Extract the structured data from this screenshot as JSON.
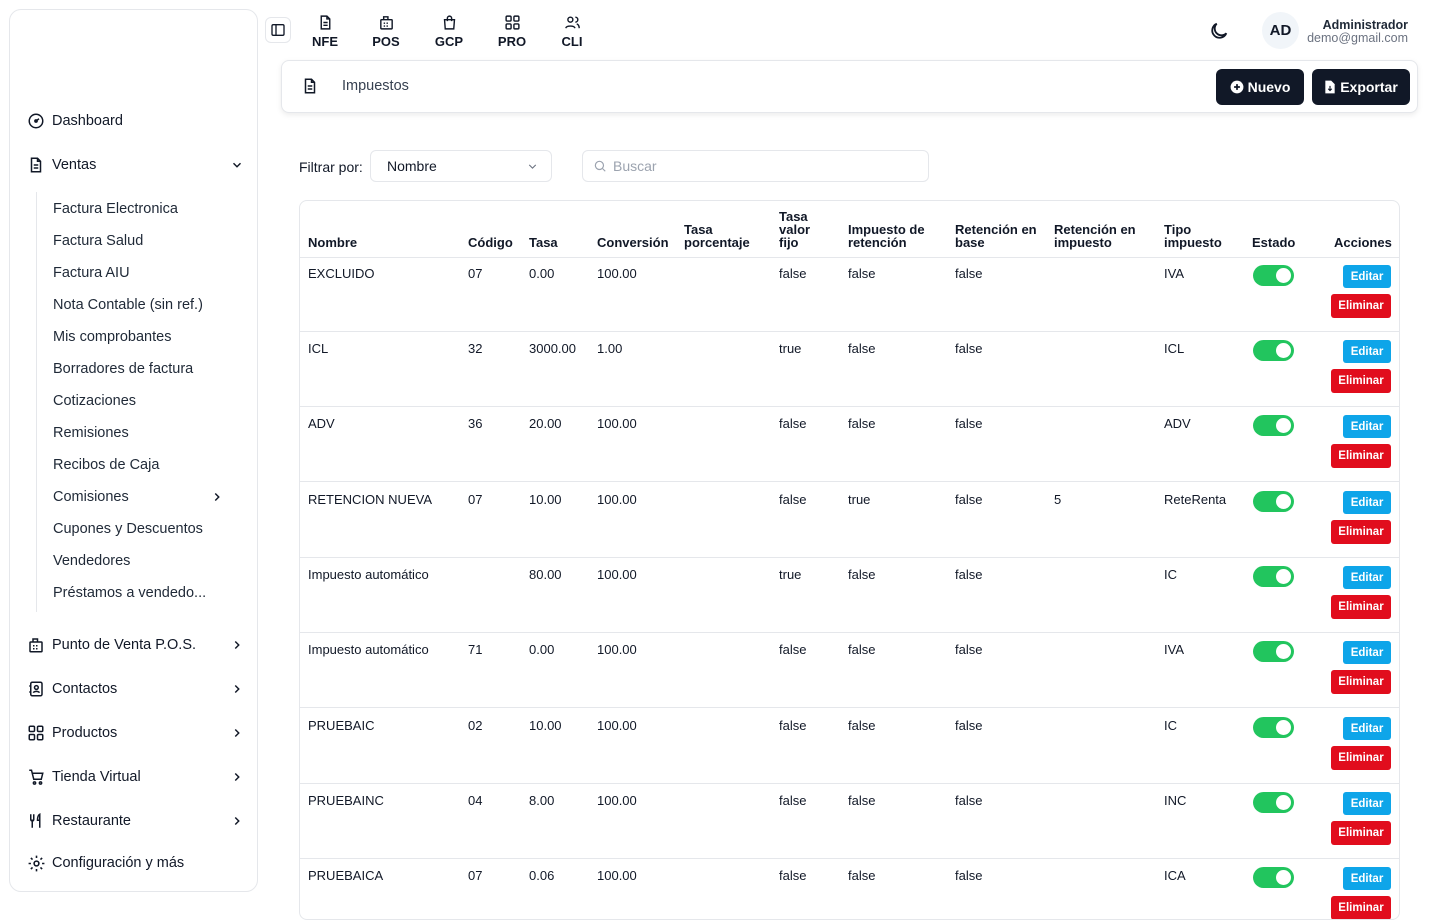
{
  "sidebar": {
    "dashboard": "Dashboard",
    "ventas": "Ventas",
    "ventas_items": [
      "Factura Electronica",
      "Factura Salud",
      "Factura AIU",
      "Nota Contable (sin ref.)",
      "Mis comprobantes",
      "Borradores de factura",
      "Cotizaciones",
      "Remisiones",
      "Recibos de Caja",
      "Comisiones",
      "Cupones y Descuentos",
      "Vendedores",
      "Préstamos a vendedo..."
    ],
    "pos": "Punto de Venta P.O.S.",
    "contactos": "Contactos",
    "productos": "Productos",
    "tienda": "Tienda Virtual",
    "restaurante": "Restaurante",
    "config": "Configuración y más"
  },
  "topbar": {
    "links": [
      "NFE",
      "POS",
      "GCP",
      "PRO",
      "CLI"
    ],
    "avatar_initials": "AD",
    "user_name": "Administrador",
    "user_email": "demo@gmail.com"
  },
  "header": {
    "title": "Impuestos",
    "new_label": "Nuevo",
    "export_label": "Exportar"
  },
  "filter": {
    "label": "Filtrar por:",
    "selected": "Nombre",
    "search_placeholder": "Buscar"
  },
  "table": {
    "headers": [
      "Nombre",
      "Código",
      "Tasa",
      "Conversión",
      "Tasa porcentaje",
      "Tasa valor fijo",
      "Impuesto de retención",
      "Retención en base",
      "Retención en impuesto",
      "Tipo impuesto",
      "Estado",
      "Acciones"
    ],
    "edit_label": "Editar",
    "delete_label": "Eliminar",
    "rows": [
      {
        "nombre": "EXCLUIDO",
        "codigo": "07",
        "tasa": "0.00",
        "conversion": "100.00",
        "tasa_porcentaje": "",
        "tasa_valor_fijo": "false",
        "impuesto_retencion": "false",
        "retencion_base": "false",
        "retencion_impuesto": "",
        "tipo": "IVA",
        "estado": true
      },
      {
        "nombre": "ICL",
        "codigo": "32",
        "tasa": "3000.00",
        "conversion": "1.00",
        "tasa_porcentaje": "",
        "tasa_valor_fijo": "true",
        "impuesto_retencion": "false",
        "retencion_base": "false",
        "retencion_impuesto": "",
        "tipo": "ICL",
        "estado": true
      },
      {
        "nombre": "ADV",
        "codigo": "36",
        "tasa": "20.00",
        "conversion": "100.00",
        "tasa_porcentaje": "",
        "tasa_valor_fijo": "false",
        "impuesto_retencion": "false",
        "retencion_base": "false",
        "retencion_impuesto": "",
        "tipo": "ADV",
        "estado": true
      },
      {
        "nombre": "RETENCION NUEVA",
        "codigo": "07",
        "tasa": "10.00",
        "conversion": "100.00",
        "tasa_porcentaje": "",
        "tasa_valor_fijo": "false",
        "impuesto_retencion": "true",
        "retencion_base": "false",
        "retencion_impuesto": "5",
        "tipo": "ReteRenta",
        "estado": true
      },
      {
        "nombre": "Impuesto automático",
        "codigo": "",
        "tasa": "80.00",
        "conversion": "100.00",
        "tasa_porcentaje": "",
        "tasa_valor_fijo": "true",
        "impuesto_retencion": "false",
        "retencion_base": "false",
        "retencion_impuesto": "",
        "tipo": "IC",
        "estado": true
      },
      {
        "nombre": "Impuesto automático",
        "codigo": "71",
        "tasa": "0.00",
        "conversion": "100.00",
        "tasa_porcentaje": "",
        "tasa_valor_fijo": "false",
        "impuesto_retencion": "false",
        "retencion_base": "false",
        "retencion_impuesto": "",
        "tipo": "IVA",
        "estado": true
      },
      {
        "nombre": "PRUEBAIC",
        "codigo": "02",
        "tasa": "10.00",
        "conversion": "100.00",
        "tasa_porcentaje": "",
        "tasa_valor_fijo": "false",
        "impuesto_retencion": "false",
        "retencion_base": "false",
        "retencion_impuesto": "",
        "tipo": "IC",
        "estado": true
      },
      {
        "nombre": "PRUEBAINC",
        "codigo": "04",
        "tasa": "8.00",
        "conversion": "100.00",
        "tasa_porcentaje": "",
        "tasa_valor_fijo": "false",
        "impuesto_retencion": "false",
        "retencion_base": "false",
        "retencion_impuesto": "",
        "tipo": "INC",
        "estado": true
      },
      {
        "nombre": "PRUEBAICA",
        "codigo": "07",
        "tasa": "0.06",
        "conversion": "100.00",
        "tasa_porcentaje": "",
        "tasa_valor_fijo": "false",
        "impuesto_retencion": "false",
        "retencion_base": "false",
        "retencion_impuesto": "",
        "tipo": "ICA",
        "estado": true
      }
    ]
  },
  "colors": {
    "accent_dark": "#111827",
    "switch_on": "#22c55e",
    "edit_button": "#0ea5e9",
    "delete_button": "#e10d1d"
  }
}
